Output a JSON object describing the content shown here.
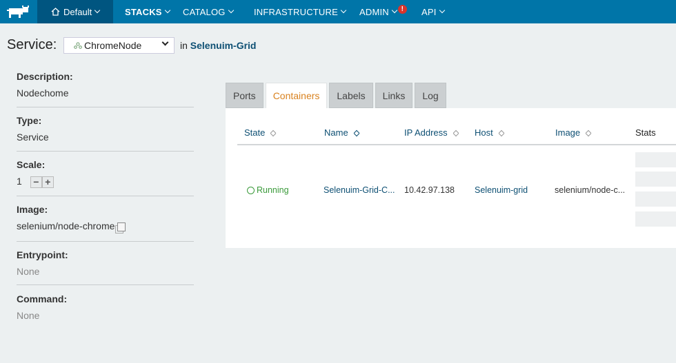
{
  "nav": {
    "environment": "Default",
    "items": [
      {
        "label": "STACKS"
      },
      {
        "label": "CATALOG"
      },
      {
        "label": "INFRASTRUCTURE"
      },
      {
        "label": "ADMIN",
        "badge": "!"
      },
      {
        "label": "API"
      }
    ]
  },
  "service": {
    "label": "Service:",
    "selected": "ChromeNode",
    "in_text": "in",
    "stack": "Selenuim-Grid"
  },
  "details": {
    "description": {
      "label": "Description:",
      "value": "Nodechome"
    },
    "type": {
      "label": "Type:",
      "value": "Service"
    },
    "scale": {
      "label": "Scale:",
      "value": "1"
    },
    "image": {
      "label": "Image:",
      "value": "selenium/node-chrome"
    },
    "entrypoint": {
      "label": "Entrypoint:",
      "value": "None"
    },
    "command": {
      "label": "Command:",
      "value": "None"
    }
  },
  "tabs": [
    "Ports",
    "Containers",
    "Labels",
    "Links",
    "Log"
  ],
  "active_tab": "Containers",
  "table": {
    "headers": [
      "State",
      "Name",
      "IP Address",
      "Host",
      "Image",
      "Stats"
    ],
    "rows": [
      {
        "state": "Running",
        "name": "Selenuim-Grid-C...",
        "ip": "10.42.97.138",
        "host": "Selenuim-grid",
        "image": "selenium/node-c..."
      }
    ]
  },
  "colors": {
    "topbar": "#0075a8",
    "env": "#005580",
    "active_tab": "#d9821f",
    "running": "#3a9a3a",
    "link": "#0d4f73"
  }
}
